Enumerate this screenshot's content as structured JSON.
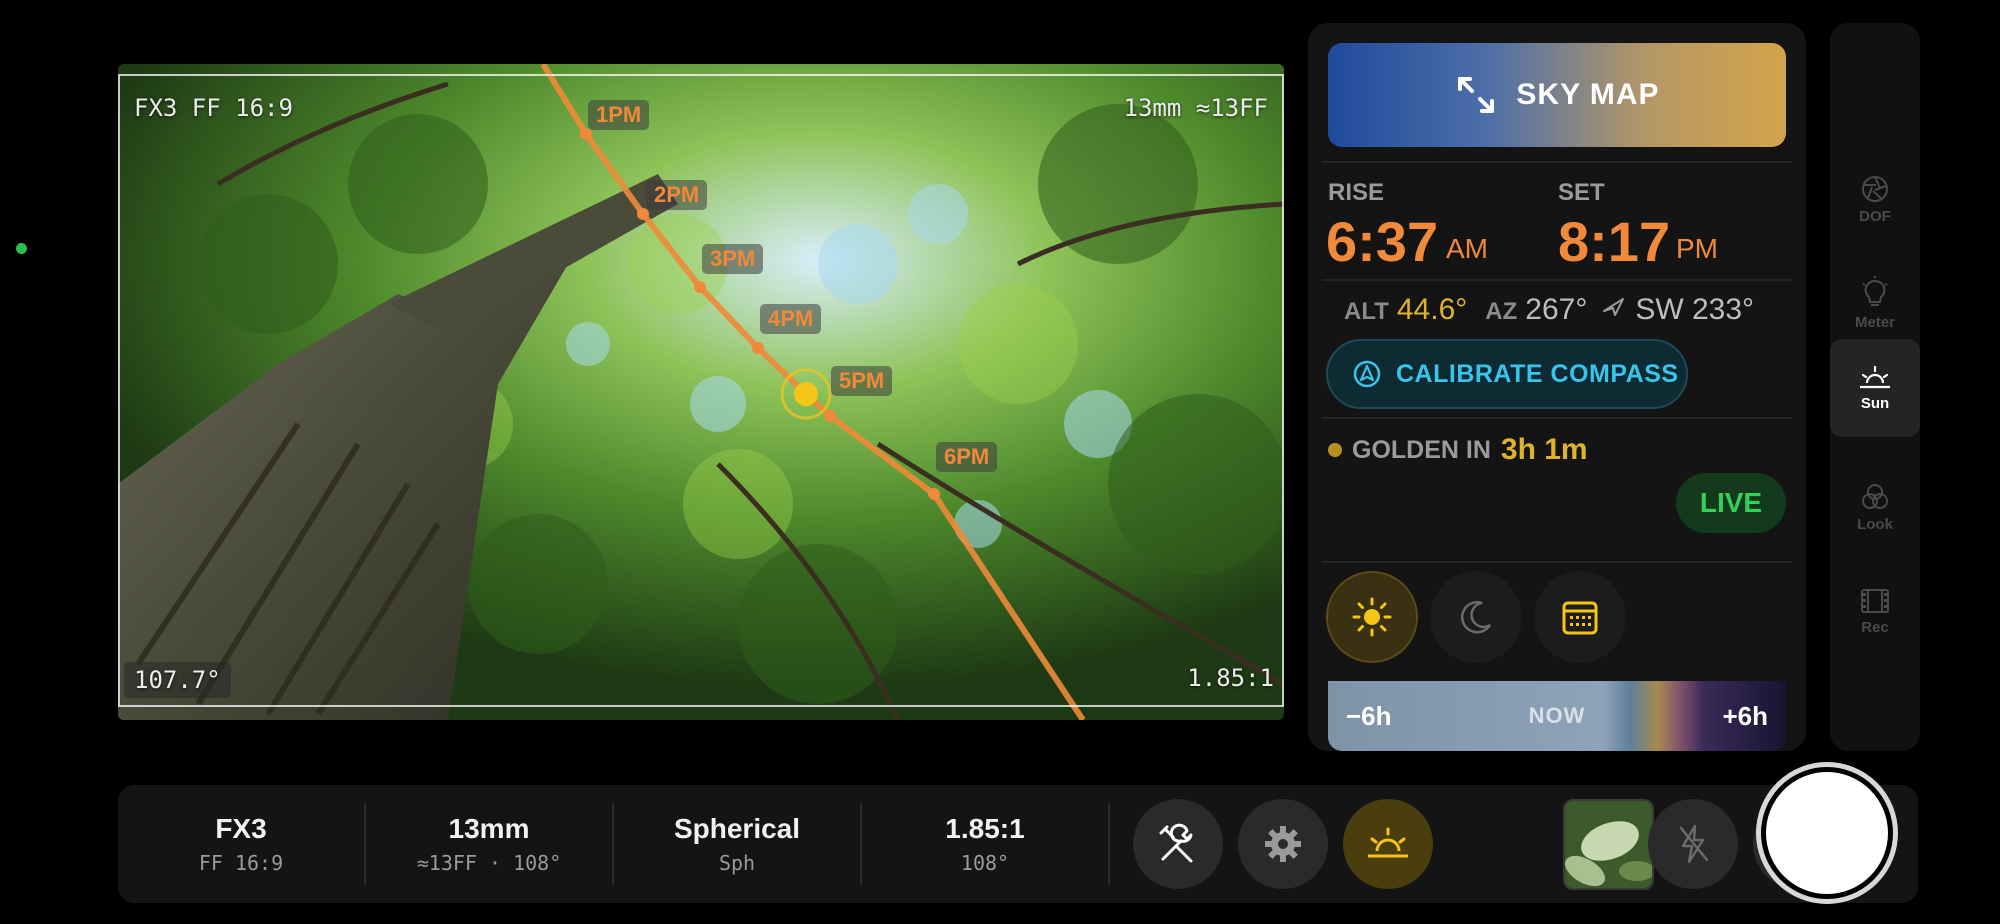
{
  "viewfinder": {
    "camera_format": "FX3 FF 16:9",
    "lens": "13mm ≈13FF",
    "fov": "107.7°",
    "aspect": "1.85:1",
    "sun_path_labels": [
      "1PM",
      "2PM",
      "3PM",
      "4PM",
      "5PM",
      "6PM"
    ]
  },
  "sun_panel": {
    "sky_map_label": "SKY MAP",
    "rise_label": "RISE",
    "rise_time": "6:37",
    "rise_ampm": "AM",
    "set_label": "SET",
    "set_time": "8:17",
    "set_ampm": "PM",
    "alt_label": "ALT",
    "alt_value": "44.6°",
    "az_label": "AZ",
    "az_value": "267°",
    "heading_value": "SW 233°",
    "calibrate_label": "CALIBRATE COMPASS",
    "golden_label": "GOLDEN IN",
    "golden_value": "3h 1m",
    "live_label": "LIVE",
    "timeline_minus": "−6h",
    "timeline_now": "NOW",
    "timeline_plus": "+6h"
  },
  "mode_rail": {
    "items": [
      {
        "label": "DOF",
        "icon": "aperture-icon"
      },
      {
        "label": "Meter",
        "icon": "lightbulb-icon"
      },
      {
        "label": "Sun",
        "icon": "sunrise-icon",
        "active": true
      },
      {
        "label": "Look",
        "icon": "look-circles-icon"
      },
      {
        "label": "Rec",
        "icon": "film-icon"
      }
    ]
  },
  "bottom_bar": {
    "camera": {
      "main": "FX3",
      "sub": "FF 16:9"
    },
    "lens": {
      "main": "13mm",
      "sub": "≈13FF · 108°"
    },
    "lens_type": {
      "main": "Spherical",
      "sub": "Sph"
    },
    "aspect": {
      "main": "1.85:1",
      "sub": "108°"
    }
  },
  "colors": {
    "accent_orange": "#f0893a",
    "gold": "#e0b42a",
    "live_green": "#34d058",
    "calibrate_cyan": "#39c4ea"
  }
}
